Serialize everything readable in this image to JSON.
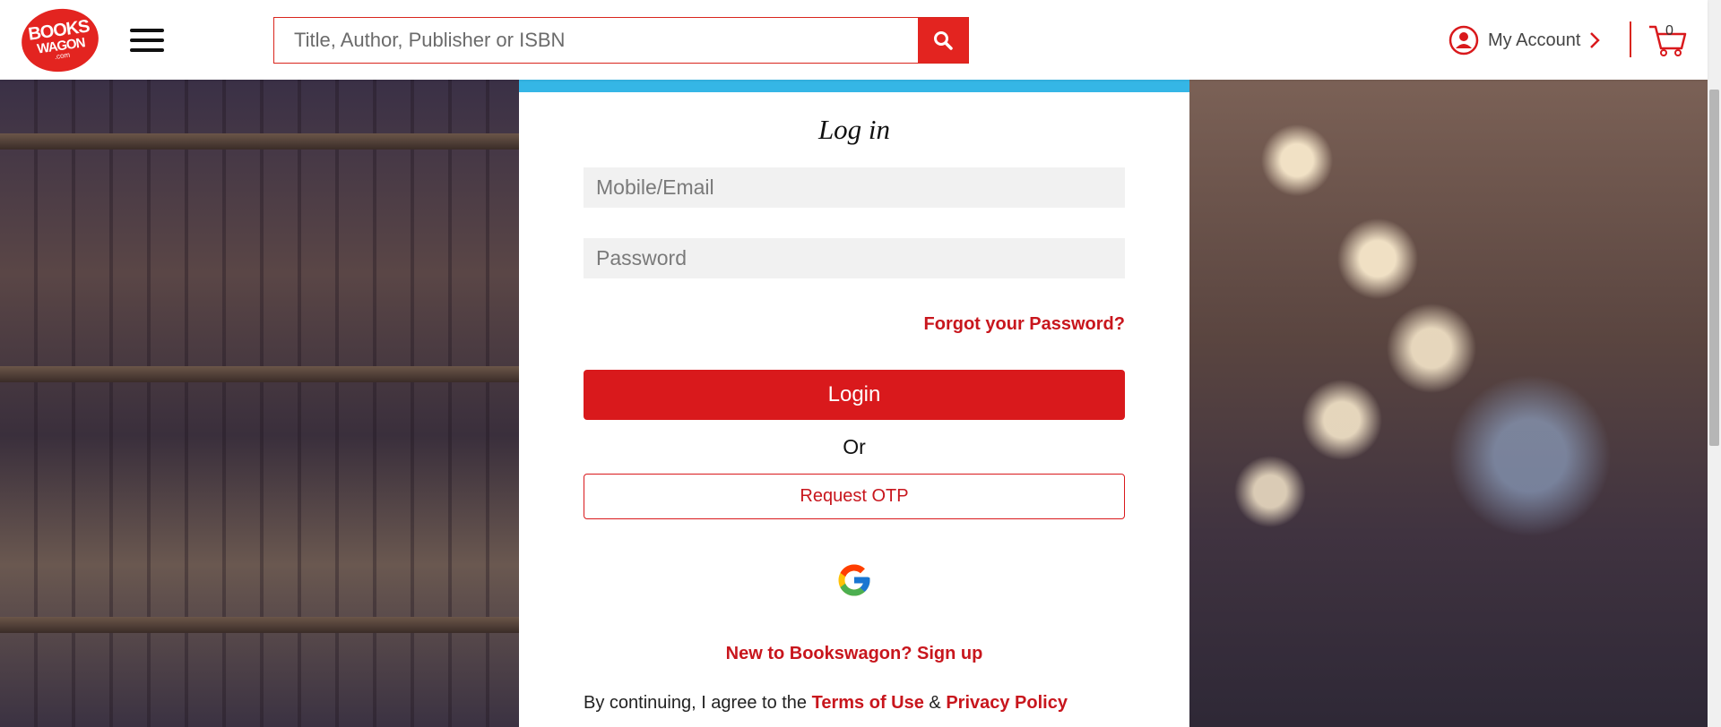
{
  "header": {
    "logo": {
      "line1": "BOOKS",
      "line2": "WAGON",
      "line3": ".com"
    },
    "search": {
      "placeholder": "Title, Author, Publisher or ISBN"
    },
    "account_label": "My Account",
    "cart_count": "0"
  },
  "login": {
    "title": "Log in",
    "mobile_placeholder": "Mobile/Email",
    "password_placeholder": "Password",
    "forgot_label": "Forgot your Password?",
    "login_label": "Login",
    "or_label": "Or",
    "otp_label": "Request OTP",
    "signup_label": "New to Bookswagon? Sign up",
    "terms_prefix": "By continuing, I agree to the",
    "terms_link": "Terms of Use",
    "terms_and": "&",
    "privacy_link": "Privacy Policy"
  },
  "colors": {
    "brand_red": "#d9191c",
    "banner_blue": "#35b6e6"
  }
}
